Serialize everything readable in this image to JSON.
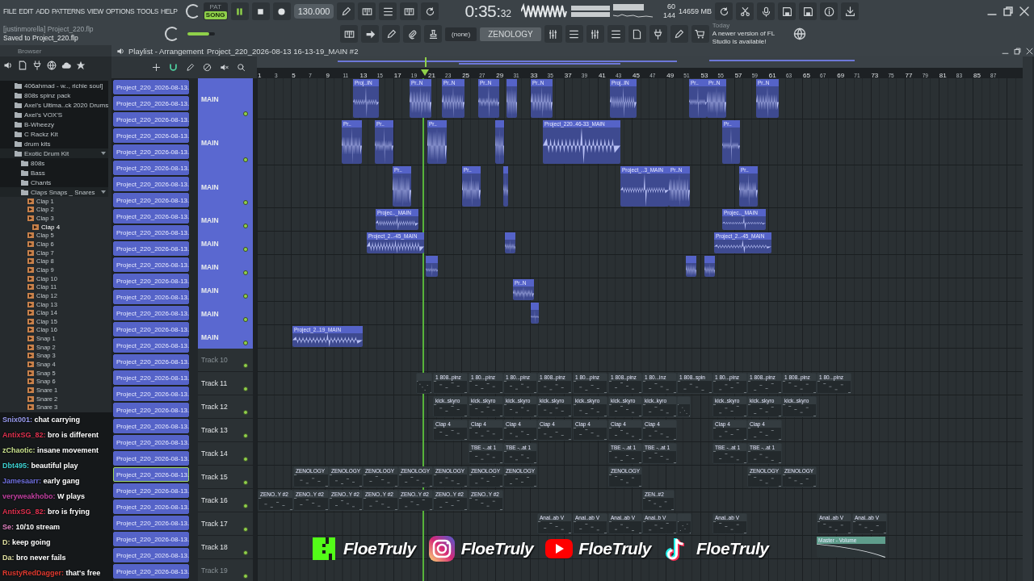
{
  "menu": [
    "FILE",
    "EDIT",
    "ADD",
    "PATTERNS",
    "VIEW",
    "OPTIONS",
    "TOOLS",
    "HELP"
  ],
  "transport": {
    "modes": [
      {
        "label": "PAT",
        "selected": false
      },
      {
        "label": "SONG",
        "selected": true
      }
    ],
    "tempo": "130.000",
    "time": "0:35:",
    "time_fraction": "32"
  },
  "meters": {
    "cpu": "60",
    "memory": "14659 MB",
    "polyphony": "144"
  },
  "hint": {
    "title": "[justinmorella] Project_220.flp",
    "message": "Saved to Project_220.flp"
  },
  "master_slider": {
    "level": 0.8
  },
  "pattern_selector": "(none)",
  "channel": "ZENOLOGY",
  "news": {
    "date": "Today",
    "message": "A newer version of FL Studio is available!"
  },
  "browser": {
    "title": "Browser",
    "items": [
      {
        "label": "406ahmad - w.., richie soul]",
        "kind": "folder",
        "selected": false
      },
      {
        "label": "808s spinz pack",
        "kind": "folder",
        "selected": false
      },
      {
        "label": "Axel's Ultima..ck 2020 Drums",
        "kind": "folder",
        "selected": false
      },
      {
        "label": "Axel's VOX'S",
        "kind": "folder",
        "selected": false
      },
      {
        "label": "B-Wheezy",
        "kind": "folder",
        "selected": false
      },
      {
        "label": "C Rackz Kit",
        "kind": "folder",
        "selected": false
      },
      {
        "label": "drum kits",
        "kind": "folder",
        "selected": false
      },
      {
        "label": "Exotic Drum Kit",
        "kind": "folder",
        "expanded": true,
        "selected": false,
        "children": [
          {
            "label": "808s",
            "kind": "folder",
            "selected": false
          },
          {
            "label": "Bass",
            "kind": "folder",
            "selected": false
          },
          {
            "label": "Chants",
            "kind": "folder",
            "selected": false
          },
          {
            "label": "Claps Snaps _ Snares",
            "kind": "folder",
            "expanded": true,
            "selected": false,
            "children": [
              {
                "label": "Clap 1",
                "kind": "sample",
                "selected": false
              },
              {
                "label": "Clap 2",
                "kind": "sample",
                "selected": false
              },
              {
                "label": "Clap 3",
                "kind": "sample",
                "selected": false
              },
              {
                "label": "Clap 4",
                "kind": "sample",
                "selected": true
              },
              {
                "label": "Clap 5",
                "kind": "sample",
                "selected": false
              },
              {
                "label": "Clap 6",
                "kind": "sample",
                "selected": false
              },
              {
                "label": "Clap 7",
                "kind": "sample",
                "selected": false
              },
              {
                "label": "Clap 8",
                "kind": "sample",
                "selected": false
              },
              {
                "label": "Clap 9",
                "kind": "sample",
                "selected": false
              },
              {
                "label": "Clap 10",
                "kind": "sample",
                "selected": false
              },
              {
                "label": "Clap 11",
                "kind": "sample",
                "selected": false
              },
              {
                "label": "Clap 12",
                "kind": "sample",
                "selected": false
              },
              {
                "label": "Clap 13",
                "kind": "sample",
                "selected": false
              },
              {
                "label": "Clap 14",
                "kind": "sample",
                "selected": false
              },
              {
                "label": "Clap 15",
                "kind": "sample",
                "selected": false
              },
              {
                "label": "Clap 16",
                "kind": "sample",
                "selected": false
              },
              {
                "label": "Snap 1",
                "kind": "sample",
                "selected": false
              },
              {
                "label": "Snap 2",
                "kind": "sample",
                "selected": false
              },
              {
                "label": "Snap 3",
                "kind": "sample",
                "selected": false
              },
              {
                "label": "Snap 4",
                "kind": "sample",
                "selected": false
              },
              {
                "label": "Snap 5",
                "kind": "sample",
                "selected": false
              },
              {
                "label": "Snap 6",
                "kind": "sample",
                "selected": false
              },
              {
                "label": "Snare 1",
                "kind": "sample",
                "selected": false
              },
              {
                "label": "Snare 2",
                "kind": "sample",
                "selected": false
              },
              {
                "label": "Snare 3",
                "kind": "sample",
                "selected": false
              }
            ]
          }
        ]
      }
    ]
  },
  "playlist": {
    "title": "Playlist - Arrangement",
    "pattern": "Project_220_2026-08-13 16-13-19_MAIN #2",
    "ruler": [
      "1",
      "3",
      "5",
      "7",
      "9",
      "11",
      "13",
      "15",
      "17",
      "19",
      "21",
      "23",
      "25",
      "27",
      "29",
      "31",
      "33",
      "35",
      "37",
      "39",
      "41",
      "43",
      "45",
      "47",
      "49",
      "51",
      "53",
      "55",
      "57",
      "59",
      "61",
      "63",
      "65",
      "67",
      "69",
      "71",
      "73",
      "75",
      "77",
      "79",
      "81",
      "83",
      "85",
      "87"
    ],
    "patterns": [
      {
        "label": "Project_220_2026-08-13..",
        "selected": false
      },
      {
        "label": "Project_220_2026-08-13..",
        "selected": false
      },
      {
        "label": "Project_220_2026-08-13..",
        "selected": false
      },
      {
        "label": "Project_220_2026-08-13..",
        "selected": false
      },
      {
        "label": "Project_220_2026-08-13..",
        "selected": false
      },
      {
        "label": "Project_220_2026-08-13..",
        "selected": false
      },
      {
        "label": "Project_220_2026-08-13..",
        "selected": false
      },
      {
        "label": "Project_220_2026-08-13..",
        "selected": false
      },
      {
        "label": "Project_220_2026-08-13..",
        "selected": false
      },
      {
        "label": "Project_220_2026-08-13..",
        "selected": false
      },
      {
        "label": "Project_220_2026-08-13..",
        "selected": false
      },
      {
        "label": "Project_220_2026-08-13..",
        "selected": false
      },
      {
        "label": "Project_220_2026-08-13..",
        "selected": false
      },
      {
        "label": "Project_220_2026-08-13..",
        "selected": false
      },
      {
        "label": "Project_220_2026-08-13..",
        "selected": false
      },
      {
        "label": "Project_220_2026-08-13..",
        "selected": false
      },
      {
        "label": "Project_220_2026-08-13..",
        "selected": false
      },
      {
        "label": "Project_220_2026-08-13..",
        "selected": false
      },
      {
        "label": "Project_220_2026-08-13..",
        "selected": false
      },
      {
        "label": "Project_220_2026-08-13..",
        "selected": false
      },
      {
        "label": "Project_220_2026-08-13..",
        "selected": false
      },
      {
        "label": "Project_220_2026-08-13..",
        "selected": false
      },
      {
        "label": "Project_220_2026-08-13..",
        "selected": false
      },
      {
        "label": "Project_220_2026-08-13..",
        "selected": false
      },
      {
        "label": "Project_220_2026-08-13..",
        "selected": true
      },
      {
        "label": "Project_220_2026-08-13..",
        "selected": false
      },
      {
        "label": "Project_220_2026-08-13..",
        "selected": false
      },
      {
        "label": "Project_220_2026-08-13..",
        "selected": false
      },
      {
        "label": "Project_220_2026-08-13..",
        "selected": false
      },
      {
        "label": "Project_220_2026-08-13..",
        "selected": false
      },
      {
        "label": "Project_220_2026-08-13..",
        "selected": false
      }
    ],
    "tracks": [
      {
        "label": "MAIN",
        "kind": "audio",
        "dimmed": false,
        "enabled": true,
        "clips": [
          {
            "label": "Proj..IN",
            "selected": false
          },
          {
            "label": "Pr..N",
            "selected": false
          },
          {
            "label": "Pr..N",
            "selected": false
          },
          {
            "label": "Pr..N",
            "selected": false
          },
          {
            "selected": false
          },
          {
            "label": "Pr..N",
            "selected": false
          },
          {
            "label": "Proj..IN",
            "selected": false
          },
          {
            "label": "Pr..",
            "selected": false
          },
          {
            "label": "Pr..N",
            "selected": false
          },
          {
            "label": "Pr..N",
            "selected": false
          }
        ]
      },
      {
        "label": "MAIN",
        "kind": "audio",
        "dimmed": false,
        "enabled": true,
        "clips": [
          {
            "label": "Pr..",
            "selected": false
          },
          {
            "label": "Pr..",
            "selected": false
          },
          {
            "label": "Pr..",
            "selected": false
          },
          {
            "selected": false
          },
          {
            "label": "Project_220..46-33_MAIN",
            "selected": false
          },
          {
            "label": "Pr..",
            "selected": false
          }
        ]
      },
      {
        "label": "MAIN",
        "kind": "audio",
        "dimmed": false,
        "enabled": true,
        "clips": [
          {
            "label": "Pr..",
            "selected": false
          },
          {
            "label": "Pr..",
            "selected": false
          },
          {
            "selected": false
          },
          {
            "label": "Project_..3_MAIN",
            "selected": false
          },
          {
            "label": "Pr..N",
            "selected": false
          },
          {
            "label": "Pr..",
            "selected": false
          }
        ]
      },
      {
        "label": "MAIN",
        "kind": "audio",
        "dimmed": false,
        "enabled": true,
        "clips": [
          {
            "label": "Projec.._MAIN",
            "selected": false
          },
          {
            "label": "Projec.._MAIN",
            "selected": false
          }
        ]
      },
      {
        "label": "MAIN",
        "kind": "audio",
        "dimmed": false,
        "enabled": true,
        "clips": [
          {
            "label": "Project_2..-45_MAIN",
            "selected": false
          },
          {
            "selected": false
          },
          {
            "label": "Project_2..-45_MAIN",
            "selected": false
          }
        ]
      },
      {
        "label": "MAIN",
        "kind": "audio",
        "dimmed": false,
        "enabled": true,
        "clips": [
          {
            "selected": false
          },
          {
            "selected": false
          },
          {
            "selected": false
          }
        ]
      },
      {
        "label": "MAIN",
        "kind": "audio",
        "dimmed": false,
        "enabled": true,
        "clips": [
          {
            "label": "Pr..N",
            "selected": false
          }
        ]
      },
      {
        "label": "MAIN",
        "kind": "audio",
        "dimmed": false,
        "enabled": true,
        "clips": [
          {
            "selected": false
          }
        ]
      },
      {
        "label": "MAIN",
        "kind": "audio",
        "dimmed": false,
        "enabled": true,
        "clips": [
          {
            "label": "Project_2..19_MAIN",
            "selected": false
          }
        ]
      },
      {
        "label": "Track 10",
        "kind": "pattern",
        "dimmed": true,
        "enabled": true
      },
      {
        "label": "Track 11",
        "kind": "pattern",
        "dimmed": false,
        "enabled": true,
        "clips": [
          {
            "selected": false
          },
          {
            "label": "1 808..pinz",
            "selected": false
          },
          {
            "label": "1 80...pinz",
            "selected": false
          },
          {
            "label": "1 80...pinz",
            "selected": false
          },
          {
            "label": "1 808..pinz",
            "selected": false
          },
          {
            "label": "1 80...pinz",
            "selected": false
          },
          {
            "label": "1 808..pinz",
            "selected": false
          },
          {
            "label": "1 80...inz",
            "selected": false
          },
          {
            "label": "1 808..spin",
            "selected": false
          },
          {
            "label": "1 80...pinz",
            "selected": false
          },
          {
            "label": "1 808..pinz",
            "selected": false
          },
          {
            "label": "1 808..pinz",
            "selected": false
          },
          {
            "label": "1 80...pinz",
            "selected": false
          }
        ]
      },
      {
        "label": "Track 12",
        "kind": "pattern",
        "dimmed": false,
        "enabled": true,
        "clips": [
          {
            "label": "kick..skyro",
            "selected": false
          },
          {
            "label": "kick..skyro",
            "selected": false
          },
          {
            "label": "kick..skyro",
            "selected": false
          },
          {
            "label": "kick..skyro",
            "selected": false
          },
          {
            "label": "kick..skyro",
            "selected": false
          },
          {
            "label": "kick..skyro",
            "selected": false
          },
          {
            "label": "kick..kyro",
            "selected": false
          },
          {
            "selected": false
          },
          {
            "label": "kick..skyro",
            "selected": false
          },
          {
            "label": "kick..skyro",
            "selected": false
          },
          {
            "label": "kick..skyro",
            "selected": false
          }
        ]
      },
      {
        "label": "Track 13",
        "kind": "pattern",
        "dimmed": false,
        "enabled": true,
        "clips": [
          {
            "label": "Clap 4",
            "selected": false
          },
          {
            "label": "Clap 4",
            "selected": false
          },
          {
            "label": "Clap 4",
            "selected": false
          },
          {
            "label": "Clap 4",
            "selected": false
          },
          {
            "label": "Clap 4",
            "selected": false
          },
          {
            "label": "Clap 4",
            "selected": false
          },
          {
            "label": "Clap 4",
            "selected": false
          },
          {
            "label": "Clap 4",
            "selected": false
          },
          {
            "label": "Clap 4",
            "selected": false
          }
        ]
      },
      {
        "label": "Track 14",
        "kind": "pattern",
        "dimmed": false,
        "enabled": true,
        "clips": [
          {
            "label": "TBE -..at 1",
            "selected": false
          },
          {
            "label": "TBE -..at 1",
            "selected": false
          },
          {
            "label": "TBE -..at 1",
            "selected": false
          },
          {
            "label": "TBE -..at 1",
            "selected": false
          },
          {
            "label": "TBE -..at 1",
            "selected": false
          },
          {
            "label": "TBE -..at 1",
            "selected": false
          }
        ]
      },
      {
        "label": "Track 15",
        "kind": "pattern",
        "dimmed": false,
        "enabled": true,
        "clips": [
          {
            "label": "ZENOLOGY",
            "selected": false
          },
          {
            "label": "ZENOLOGY",
            "selected": false
          },
          {
            "label": "ZENOLOGY",
            "selected": false
          },
          {
            "label": "ZENOLOGY",
            "selected": false
          },
          {
            "label": "ZENOLOGY",
            "selected": false
          },
          {
            "label": "ZENOLOGY",
            "selected": false
          },
          {
            "label": "ZENOLOGY",
            "selected": false
          },
          {
            "label": "ZENOLOGY",
            "selected": false
          },
          {
            "label": "ZENOLOGY",
            "selected": false
          },
          {
            "label": "ZENOLOGY",
            "selected": false
          }
        ]
      },
      {
        "label": "Track 16",
        "kind": "pattern",
        "dimmed": false,
        "enabled": true,
        "clips": [
          {
            "label": "ZENO..Y #2",
            "selected": false
          },
          {
            "label": "ZENO..Y #2",
            "selected": false
          },
          {
            "label": "ZENO..Y #2",
            "selected": false
          },
          {
            "label": "ZENO..Y #2",
            "selected": false
          },
          {
            "label": "ZENO..Y #2",
            "selected": false
          },
          {
            "label": "ZENO..Y #2",
            "selected": false
          },
          {
            "label": "ZENO..Y #2",
            "selected": false
          },
          {
            "label": "ZEN..#2",
            "selected": false
          }
        ]
      },
      {
        "label": "Track 17",
        "kind": "pattern",
        "dimmed": false,
        "enabled": true,
        "clips": [
          {
            "label": "Anal..ab V",
            "selected": false
          },
          {
            "label": "Anal..ab V",
            "selected": false
          },
          {
            "label": "Anal..ab V",
            "selected": false
          },
          {
            "label": "Anal..b V",
            "selected": false
          },
          {
            "selected": false
          },
          {
            "label": "Anal..ab V",
            "selected": false
          },
          {
            "label": "Anal..ab V",
            "selected": false
          },
          {
            "label": "Anal..ab V",
            "selected": false
          }
        ]
      },
      {
        "label": "Track 18",
        "kind": "automation",
        "dimmed": false,
        "enabled": true,
        "clips": [
          {
            "label": "Master - Volume",
            "selected": false
          }
        ]
      },
      {
        "label": "Track 19",
        "kind": "pattern",
        "dimmed": true,
        "enabled": true
      }
    ]
  },
  "chat": [
    {
      "user": "Snix001:",
      "message": "chat carrying",
      "color": "#9a9cf0"
    },
    {
      "user": "AntixSG_82:",
      "message": "bro is different",
      "color": "#e0314f"
    },
    {
      "user": "zChaotic:",
      "message": "insane movement",
      "color": "#c8e08c"
    },
    {
      "user": "Dbt495:",
      "message": "beautiful play",
      "color": "#3ccfcf"
    },
    {
      "user": "Jamesaarr:",
      "message": "early gang",
      "color": "#7070e0"
    },
    {
      "user": "veryweakhobo:",
      "message": "W plays",
      "color": "#c040a0"
    },
    {
      "user": "AntixSG_82:",
      "message": "bro is frying",
      "color": "#e0314f"
    },
    {
      "user": "Se:",
      "message": "10/10 stream",
      "color": "#e080c0"
    },
    {
      "user": "D:",
      "message": "keep going",
      "color": "#e0e0a0"
    },
    {
      "user": "Da:",
      "message": "bro never fails",
      "color": "#e0e0a0"
    },
    {
      "user": "RustyRedDagger:",
      "message": "that's free",
      "color": "#e03a30"
    }
  ],
  "socials": [
    {
      "kind": "kick",
      "handle": "FloeTruly"
    },
    {
      "kind": "instagram",
      "handle": "FloeTruly"
    },
    {
      "kind": "youtube",
      "handle": "FloeTruly"
    },
    {
      "kind": "tiktok",
      "handle": "FloeTruly"
    }
  ]
}
